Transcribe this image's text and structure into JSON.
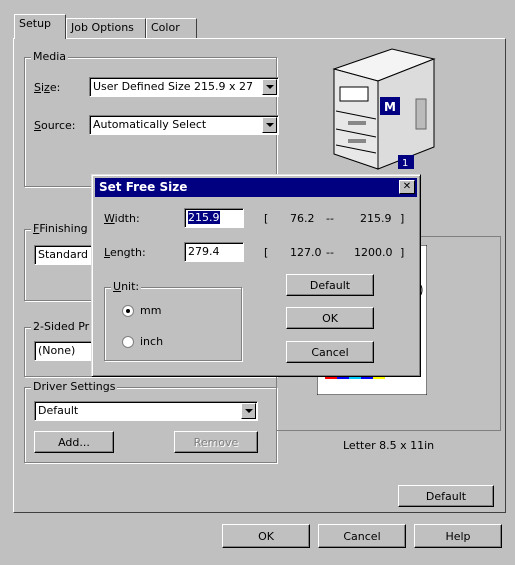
{
  "tabs": [
    {
      "label": "Setup",
      "active": true
    },
    {
      "label": "Job Options",
      "active": false
    },
    {
      "label": "Color",
      "active": false
    }
  ],
  "media": {
    "title": "Media",
    "size_label": "Size:",
    "size_value": "User Defined Size 215.9 x 27",
    "source_label": "Source:",
    "source_value": "Automatically Select"
  },
  "finishing": {
    "title": "Finishing M",
    "value": "Standard"
  },
  "two_sided": {
    "title": "2-Sided Pr",
    "value": "(None)"
  },
  "driver": {
    "title": "Driver Settings",
    "value": "Default",
    "add_label": "Add...",
    "remove_label": "Remove"
  },
  "preview": {
    "caption": "Letter 8.5 x 11in",
    "printer_badge": "M",
    "tray_number": "1"
  },
  "panel_default_label": "Default",
  "footer": {
    "ok": "OK",
    "cancel": "Cancel",
    "help": "Help"
  },
  "dialog": {
    "title": "Set Free Size",
    "width_label": "Width:",
    "width_value": "215.9",
    "width_min": "76.2",
    "width_max": "215.9",
    "length_label": "Length:",
    "length_value": "279.4",
    "length_min": "127.0",
    "length_max": "1200.0",
    "bracket_open": "[",
    "bracket_close": "]",
    "range_sep": "--",
    "unit_title": "Unit:",
    "unit_mm": "mm",
    "unit_inch": "inch",
    "unit_selected": "mm",
    "default_label": "Default",
    "ok_label": "OK",
    "cancel_label": "Cancel"
  },
  "colors": {
    "title_bar": "#000080",
    "face": "#c0c0c0",
    "selection": "#000080"
  }
}
